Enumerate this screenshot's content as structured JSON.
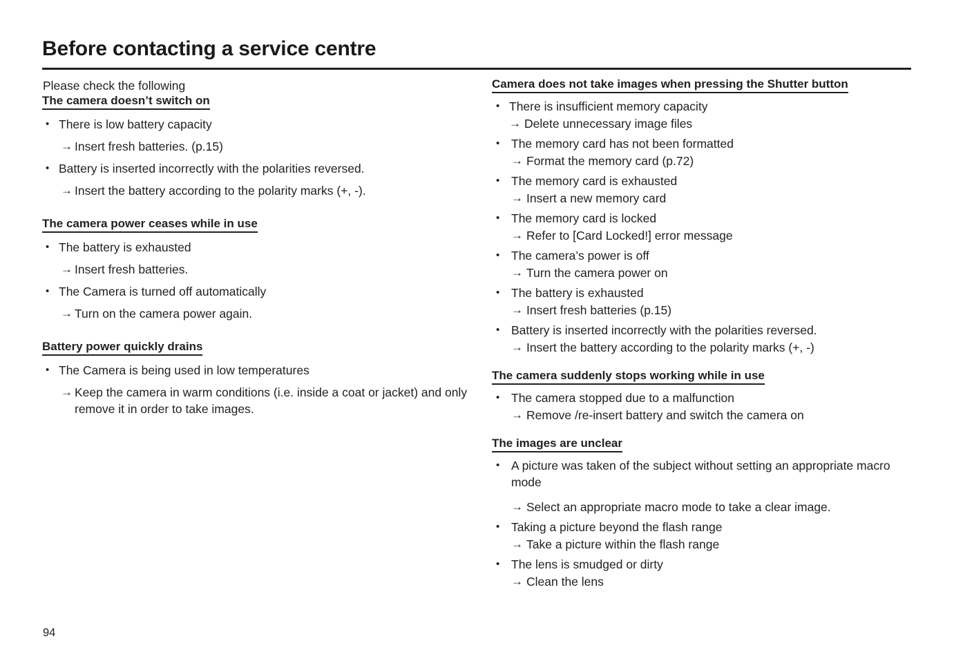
{
  "page": {
    "title": "Before contacting a service centre",
    "intro": "Please check the following",
    "page_number": "94",
    "bullet_glyph": "•",
    "arrow_glyph": "→",
    "text_color": "#231f20",
    "background_color": "#ffffff"
  },
  "left_column": {
    "sections": [
      {
        "heading": "The camera doesn’t switch on",
        "items": [
          {
            "bullet": "There is low battery capacity",
            "arrow": "Insert fresh batteries. (p.15)"
          },
          {
            "bullet": "Battery is inserted incorrectly with the polarities reversed.",
            "arrow": "Insert the battery according to the polarity marks (+, -)."
          }
        ]
      },
      {
        "heading": "The camera power ceases while in use",
        "items": [
          {
            "bullet": "The battery is exhausted",
            "arrow": "Insert fresh batteries."
          },
          {
            "bullet": "The Camera is turned off automatically",
            "arrow": "Turn on the camera power again."
          }
        ]
      },
      {
        "heading": "Battery power quickly drains",
        "items": [
          {
            "bullet": "The Camera is being used in low temperatures",
            "arrow": "Keep the camera in warm conditions (i.e. inside a coat or jacket) and only remove it in order to take images."
          }
        ]
      }
    ]
  },
  "right_column": {
    "sections": [
      {
        "heading": "Camera does not take images when pressing the Shutter button",
        "items": [
          {
            "bullet": "There is insufficient memory capacity",
            "arrow": "Delete unnecessary image files"
          },
          {
            "bullet": "The memory card has not been formatted",
            "arrow": "Format the memory card (p.72)"
          },
          {
            "bullet": "The memory card is exhausted",
            "arrow": "Insert a new memory card"
          },
          {
            "bullet": "The memory card is locked",
            "arrow": "Refer to [Card Locked!] error message"
          },
          {
            "bullet": "The camera’s power is off",
            "arrow": "Turn the camera power on"
          },
          {
            "bullet": "The battery is exhausted",
            "arrow": "Insert fresh batteries (p.15)"
          },
          {
            "bullet": "Battery is inserted incorrectly with the polarities reversed.",
            "arrow": "Insert the battery according to the polarity marks (+, -)"
          }
        ]
      },
      {
        "heading": "The camera suddenly stops working while in use",
        "items": [
          {
            "bullet": "The camera stopped due to a malfunction",
            "arrow": "Remove /re-insert battery and switch the camera on"
          }
        ]
      },
      {
        "heading": "The images are unclear",
        "items": [
          {
            "bullet": "A picture was taken of the subject without setting an appropriate macro mode",
            "arrow": "Select an appropriate macro mode to take a clear image."
          },
          {
            "bullet": "Taking a picture beyond the flash range",
            "arrow": "Take a picture within the flash range"
          },
          {
            "bullet": "The lens is smudged or dirty",
            "arrow": "Clean the lens"
          }
        ]
      }
    ]
  }
}
